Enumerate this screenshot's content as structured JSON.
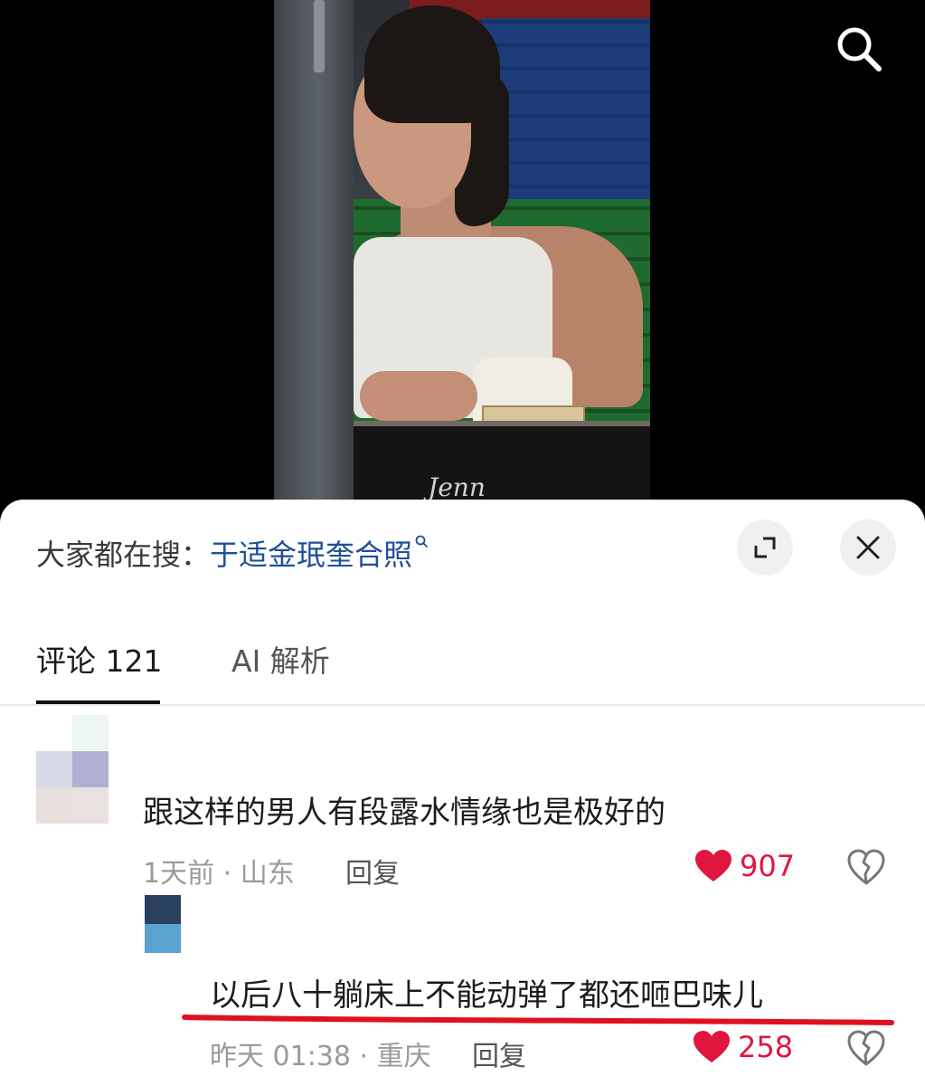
{
  "video": {
    "watermark": "Jenn"
  },
  "sheet": {
    "trending_prefix": "大家都在搜：",
    "trending_term": "于适金珉奎合照"
  },
  "tabs": [
    {
      "label": "评论 121",
      "active": true
    },
    {
      "label": "AI 解析",
      "active": false
    }
  ],
  "comments": [
    {
      "text": "跟这样的男人有段露水情缘也是极好的",
      "meta": "1天前 · 山东",
      "reply_label": "回复",
      "likes": "907"
    },
    {
      "text": "以后八十躺床上不能动弹了都还咂巴味儿",
      "meta": "昨天 01:38 · 重庆",
      "reply_label": "回复",
      "likes": "258"
    }
  ],
  "colors": {
    "accent_link": "#1f4f97",
    "like_red": "#e0163f",
    "highlight_underline": "#e01020"
  }
}
